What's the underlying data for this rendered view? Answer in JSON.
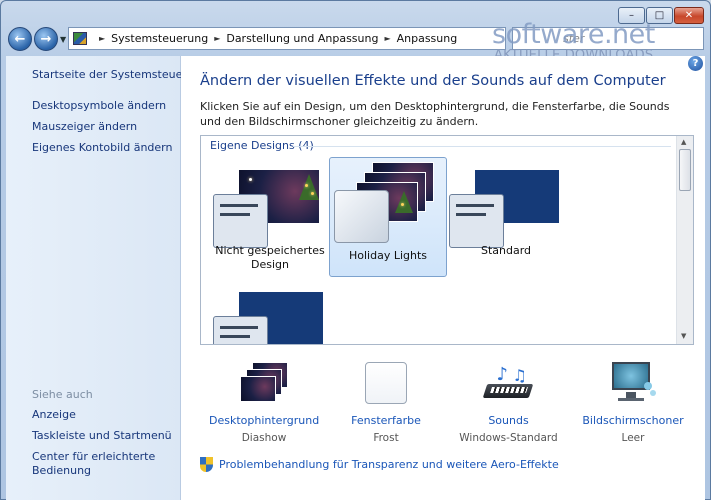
{
  "window": {
    "minimize_glyph": "–",
    "maximize_glyph": "□",
    "close_glyph": "✕"
  },
  "nav": {
    "back_glyph": "←",
    "forward_glyph": "→",
    "dropdown_glyph": "▼",
    "breadcrumbs": [
      "Systemsteuerung",
      "Darstellung und Anpassung",
      "Anpassung"
    ],
    "breadcrumb_separator": "►",
    "search_placeholder": "ster"
  },
  "watermark": {
    "title": "software.net",
    "subtitle": "AKTUELLE DOWNLOADS"
  },
  "sidebar": {
    "home_link": "Startseite der Systemsteuerung",
    "links": [
      "Desktopsymbole ändern",
      "Mauszeiger ändern",
      "Eigenes Kontobild ändern"
    ],
    "see_also_heading": "Siehe auch",
    "see_also_links": [
      "Anzeige",
      "Taskleiste und Startmenü",
      "Center für erleichterte Bedienung"
    ]
  },
  "main": {
    "help_glyph": "?",
    "title": "Ändern der visuellen Effekte und der Sounds auf dem Computer",
    "description": "Klicken Sie auf ein Design, um den Desktophintergrund, die Fensterfarbe, die Sounds und den Bildschirmschoner gleichzeitig zu ändern.",
    "group_label": "Eigene Designs (4)",
    "themes": [
      {
        "label": "Nicht gespeichertes Design",
        "selected": false
      },
      {
        "label": "Holiday Lights",
        "selected": true
      },
      {
        "label": "Standard",
        "selected": false
      },
      {
        "label": "",
        "selected": false
      }
    ],
    "scroll_up_glyph": "▲",
    "scroll_down_glyph": "▼"
  },
  "toolbar": {
    "items": [
      {
        "label": "Desktophintergrund",
        "value": "Diashow",
        "icon": "desktop-background-icon"
      },
      {
        "label": "Fensterfarbe",
        "value": "Frost",
        "icon": "window-color-icon"
      },
      {
        "label": "Sounds",
        "value": "Windows-Standard",
        "icon": "sounds-icon"
      },
      {
        "label": "Bildschirmschoner",
        "value": "Leer",
        "icon": "screensaver-icon"
      }
    ]
  },
  "troubleshoot": {
    "label": "Problembehandlung für Transparenz und weitere Aero-Effekte",
    "icon": "uac-shield-icon"
  },
  "colors": {
    "link": "#1a56b8",
    "title": "#1a3f8c",
    "selection": "#cfe4fa"
  }
}
